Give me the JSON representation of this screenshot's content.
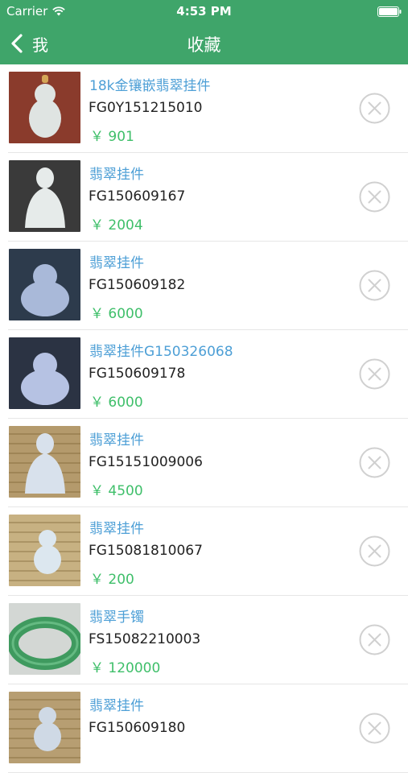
{
  "status_bar": {
    "carrier": "Carrier",
    "time": "4:53 PM",
    "wifi_icon": "wifi-icon",
    "battery_icon": "battery-icon"
  },
  "nav": {
    "back_label": "我",
    "back_icon": "chevron-left-icon",
    "title": "收藏",
    "bar_color": "#3fa56a"
  },
  "colors": {
    "name": "#4d9fd6",
    "price": "#3fbf6a",
    "delete_icon": "#d0d0d0"
  },
  "items": [
    {
      "name": "18k金镶嵌翡翠挂件",
      "code": "FG0Y151215010",
      "price": "￥ 901",
      "thumb": "jade-pendant-gourd",
      "bg": "#8a3b2c",
      "jade": "#dfe4e2"
    },
    {
      "name": "翡翠挂件",
      "code": "FG150609167",
      "price": "￥ 2004",
      "thumb": "jade-pendant-guanyin",
      "bg": "#3a3a3a",
      "jade": "#e6ebea"
    },
    {
      "name": "翡翠挂件",
      "code": "FG150609182",
      "price": "￥ 6000",
      "thumb": "jade-pendant-buddha",
      "bg": "#2d3b4c",
      "jade": "#a9b9d9"
    },
    {
      "name": "翡翠挂件G150326068",
      "code": "FG150609178",
      "price": "￥ 6000",
      "thumb": "jade-pendant-buddha",
      "bg": "#2b3343",
      "jade": "#b6c2e3"
    },
    {
      "name": "翡翠挂件",
      "code": "FG15151009006",
      "price": "￥ 4500",
      "thumb": "jade-pendant-guanyin",
      "bg": "#b49a6c",
      "jade": "#d8e1ec"
    },
    {
      "name": "翡翠挂件",
      "code": "FG15081810067",
      "price": "￥ 200",
      "thumb": "jade-pendant-small",
      "bg": "#c7b182",
      "jade": "#dce7ef"
    },
    {
      "name": "翡翠手镯",
      "code": "FS15082210003",
      "price": "￥ 120000",
      "thumb": "jade-bangle",
      "bg": "#d3d7d4",
      "jade": "#3f9a5f"
    },
    {
      "name": "翡翠挂件",
      "code": "FG150609180",
      "price": "",
      "thumb": "jade-pendant-small",
      "bg": "#b79e72",
      "jade": "#cfd9e5"
    }
  ]
}
